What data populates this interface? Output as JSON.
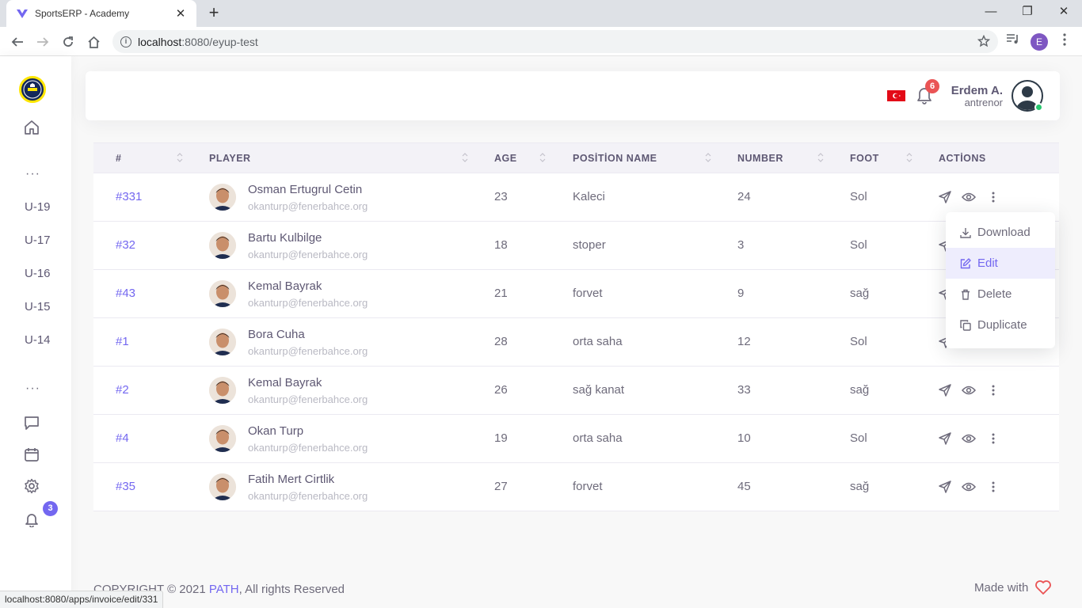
{
  "browser": {
    "tab_title": "SportsERP - Academy",
    "url_host": "localhost",
    "url_path": ":8080/eyup-test",
    "profile_initial": "E",
    "status_url": "localhost:8080/apps/invoice/edit/331",
    "window_controls": {
      "minimize": "—",
      "restore": "❐",
      "close": "✕"
    },
    "new_tab": "+",
    "tab_close": "✕"
  },
  "sidebar": {
    "logo": "club-crest",
    "dots": "···",
    "teams": [
      "U-19",
      "U-17",
      "U-16",
      "U-15",
      "U-14"
    ],
    "notification_count": "3"
  },
  "header": {
    "notification_count": "6",
    "user_name": "Erdem A.",
    "user_role": "antrenor"
  },
  "table": {
    "columns": [
      "#",
      "PLAYER",
      "AGE",
      "POSİTİON NAME",
      "NUMBER",
      "FOOT",
      "ACTİONS"
    ],
    "rows": [
      {
        "id": "#331",
        "name": "Osman Ertugrul Cetin",
        "email": "okanturp@fenerbahce.org",
        "age": "23",
        "position": "Kaleci",
        "number": "24",
        "foot": "Sol"
      },
      {
        "id": "#32",
        "name": "Bartu Kulbilge",
        "email": "okanturp@fenerbahce.org",
        "age": "18",
        "position": "stoper",
        "number": "3",
        "foot": "Sol"
      },
      {
        "id": "#43",
        "name": "Kemal Bayrak",
        "email": "okanturp@fenerbahce.org",
        "age": "21",
        "position": "forvet",
        "number": "9",
        "foot": "sağ"
      },
      {
        "id": "#1",
        "name": "Bora Cuha",
        "email": "okanturp@fenerbahce.org",
        "age": "28",
        "position": "orta saha",
        "number": "12",
        "foot": "Sol"
      },
      {
        "id": "#2",
        "name": "Kemal Bayrak",
        "email": "okanturp@fenerbahce.org",
        "age": "26",
        "position": "sağ kanat",
        "number": "33",
        "foot": "sağ"
      },
      {
        "id": "#4",
        "name": "Okan Turp",
        "email": "okanturp@fenerbahce.org",
        "age": "19",
        "position": "orta saha",
        "number": "10",
        "foot": "Sol"
      },
      {
        "id": "#35",
        "name": "Fatih Mert Cirtlik",
        "email": "okanturp@fenerbahce.org",
        "age": "27",
        "position": "forvet",
        "number": "45",
        "foot": "sağ"
      }
    ]
  },
  "dropdown": {
    "items": [
      "Download",
      "Edit",
      "Delete",
      "Duplicate"
    ],
    "active": "Edit"
  },
  "footer": {
    "copyright_prefix": "COPYRIGHT © 2021 ",
    "brand": "PATH",
    "copyright_suffix": ", All rights Reserved",
    "made_with": "Made with"
  },
  "colors": {
    "primary": "#7367f0",
    "danger": "#ea5455",
    "success": "#28c76f",
    "text": "#6e6b7b",
    "heading": "#5e5873",
    "muted": "#b9b9c3"
  }
}
